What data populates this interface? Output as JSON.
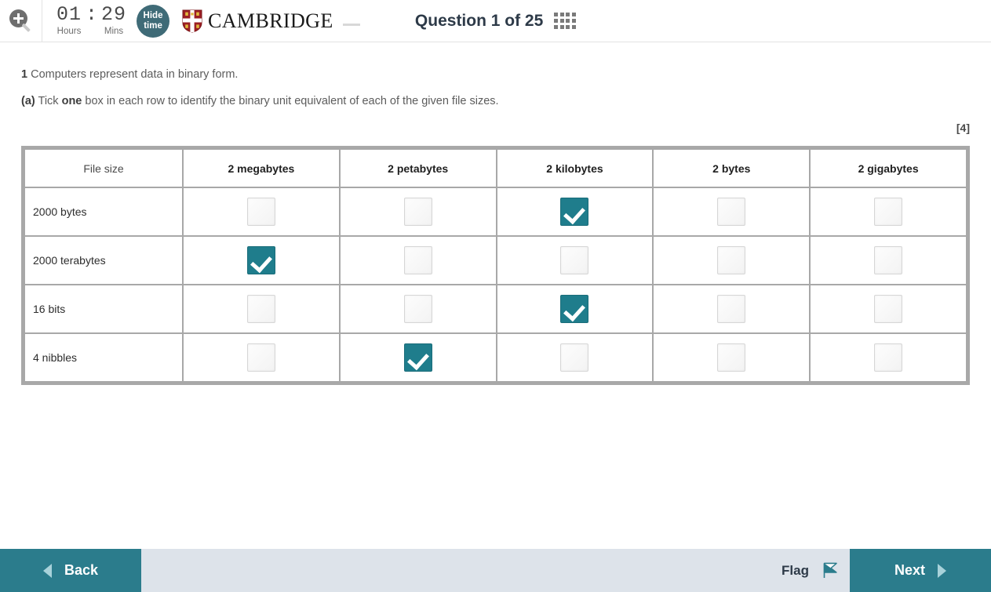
{
  "header": {
    "zoom_icon": "zoom-in-magnifier-icon",
    "timer": {
      "hours_value": "01",
      "hours_label": "Hours",
      "colon": ":",
      "mins_value": "29",
      "mins_label": "Mins"
    },
    "hide_time": {
      "line1": "Hide",
      "line2": "time"
    },
    "brand": {
      "name": "CAMBRIDGE",
      "crest_icon": "cambridge-crest-icon"
    },
    "question_title": "Question 1 of 25",
    "grid_icon": "question-grid-icon"
  },
  "question": {
    "number": "1",
    "stem": "Computers represent data in binary form.",
    "part_label": "(a)",
    "part_text_before": "Tick",
    "part_emphasis": "one",
    "part_text_after": "box in each row to identify the binary unit equivalent of each of the given file sizes.",
    "marks": "[4]"
  },
  "table": {
    "columns": [
      "File size",
      "2 megabytes",
      "2 petabytes",
      "2 kilobytes",
      "2 bytes",
      "2 gigabytes"
    ],
    "rows": [
      {
        "label": "2000 bytes",
        "checked": [
          false,
          false,
          true,
          false,
          false
        ]
      },
      {
        "label": "2000 terabytes",
        "checked": [
          true,
          false,
          false,
          false,
          false
        ]
      },
      {
        "label": "16 bits",
        "checked": [
          false,
          false,
          true,
          false,
          false
        ]
      },
      {
        "label": "4 nibbles",
        "checked": [
          false,
          true,
          false,
          false,
          false
        ]
      }
    ]
  },
  "footer": {
    "back_label": "Back",
    "flag_label": "Flag",
    "next_label": "Next",
    "back_icon": "triangle-left-icon",
    "next_icon": "triangle-right-icon",
    "flag_icon": "flag-icon"
  },
  "colors": {
    "teal": "#2b7c8c",
    "checkbox_teal": "#1f7d8c",
    "footer_bg": "#dde3ea",
    "hide_time_bg": "#3f6b77",
    "table_grid": "#a8a8a8"
  }
}
